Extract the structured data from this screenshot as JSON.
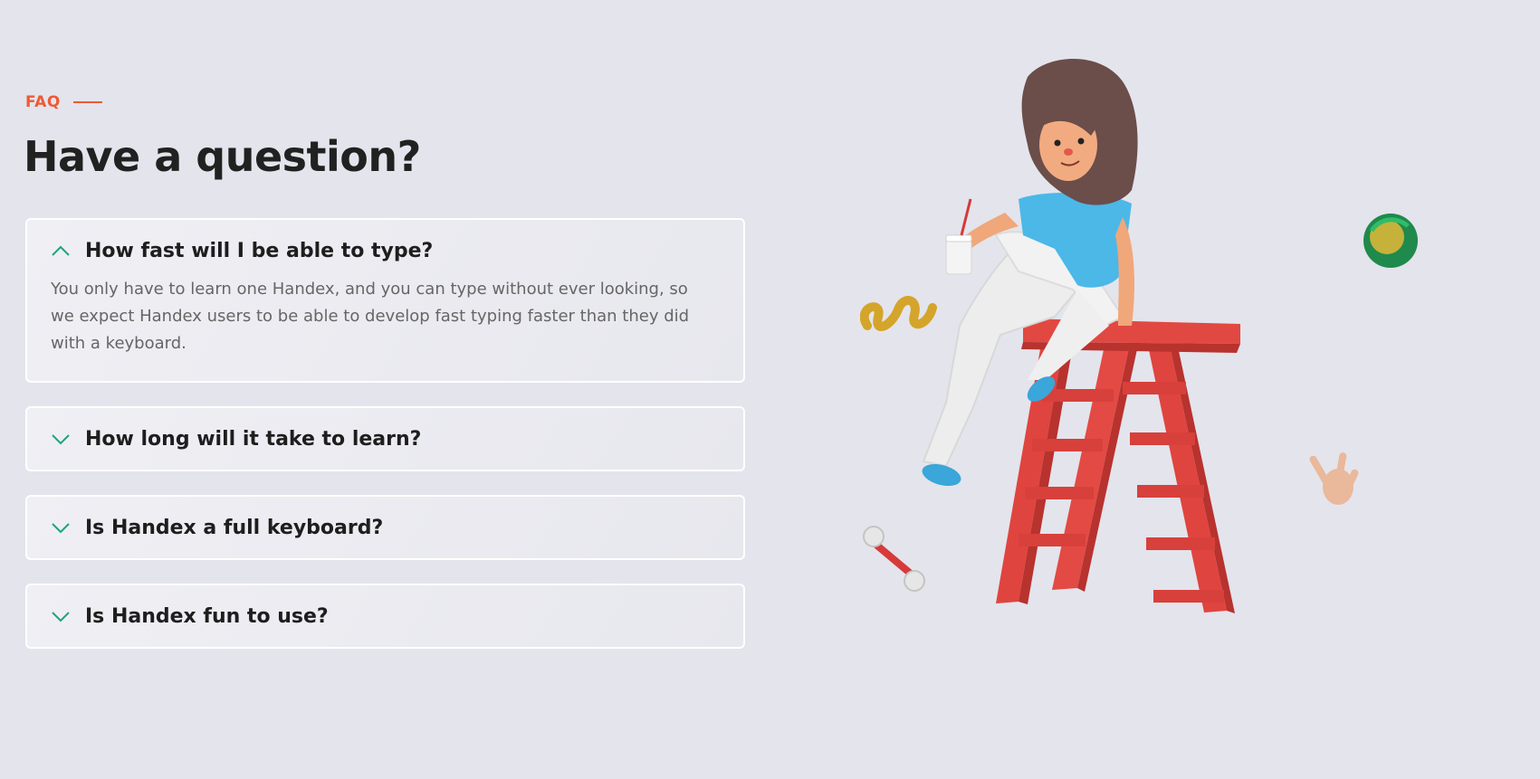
{
  "section": {
    "eyebrow": "FAQ",
    "title": "Have a question?"
  },
  "faq": [
    {
      "question": "How fast will I be able to type?",
      "answer": "You only have to learn one Handex, and you can type without ever looking, so we expect Handex users to be able to develop fast typing faster than they did with a keyboard.",
      "expanded": true
    },
    {
      "question": "How long will it take to learn?",
      "expanded": false
    },
    {
      "question": "Is Handex a full keyboard?",
      "expanded": false
    },
    {
      "question": "Is Handex fun to use?",
      "expanded": false
    }
  ],
  "icons": {
    "expanded": "chevron-up-icon",
    "collapsed": "chevron-down-icon"
  },
  "colors": {
    "background": "#e4e4ec",
    "accent": "#ee5a36",
    "chevron": "#1fa37a",
    "heading": "#212121",
    "body_text": "#666666"
  }
}
